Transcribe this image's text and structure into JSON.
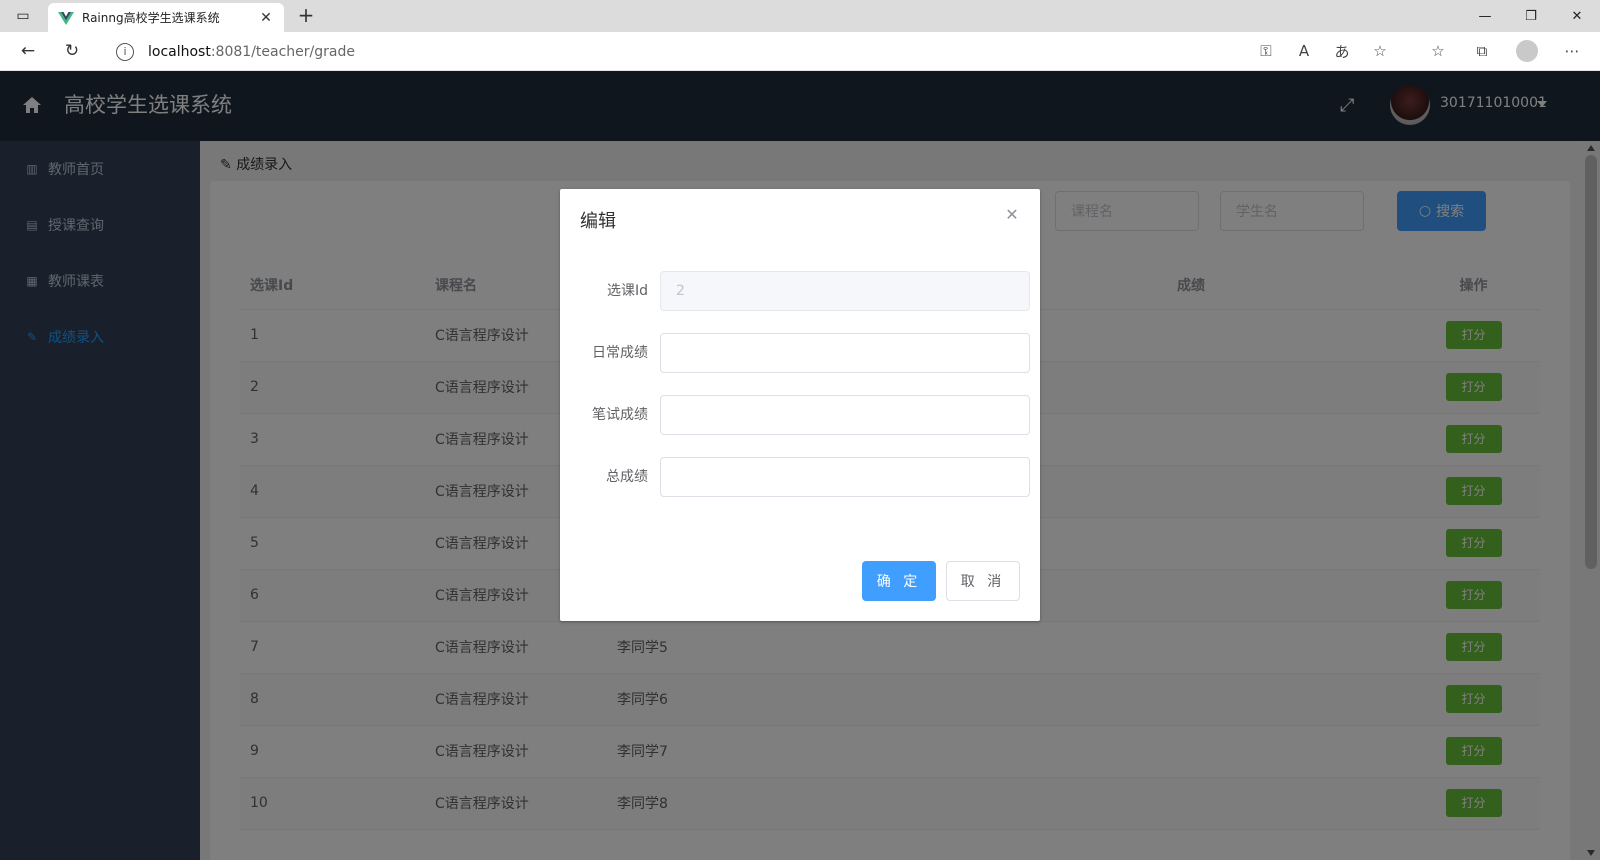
{
  "browser": {
    "tab_title": "Rainng高校学生选课系统",
    "url_host": "localhost",
    "url_path": ":8081/teacher/grade",
    "icons": [
      "sidebar-toggle-icon",
      "vue-logo-icon",
      "close-icon",
      "plus-icon",
      "back-icon",
      "reload-icon",
      "info-icon",
      "key-icon",
      "read-aloud-icon",
      "translate-icon",
      "favorite-add-icon",
      "favorites-icon",
      "collections-icon",
      "profile-icon",
      "more-icon"
    ]
  },
  "header": {
    "title": "高校学生选课系统",
    "username": "301711010001"
  },
  "sidebar": {
    "items": [
      {
        "label": "教师首页",
        "icon": "bar-chart-icon"
      },
      {
        "label": "授课查询",
        "icon": "book-icon"
      },
      {
        "label": "教师课表",
        "icon": "table-icon"
      },
      {
        "label": "成绩录入",
        "icon": "edit-icon",
        "active": true
      }
    ]
  },
  "main": {
    "breadcrumb": "成绩录入",
    "search": {
      "course_placeholder": "课程名",
      "student_placeholder": "学生名",
      "button_label": "搜索"
    },
    "table": {
      "columns": [
        "选课Id",
        "课程名",
        "",
        "",
        "成绩",
        "操作"
      ],
      "action_label": "打分",
      "rows": [
        {
          "id": "1",
          "course": "C语言程序设计",
          "student": ""
        },
        {
          "id": "2",
          "course": "C语言程序设计",
          "student": ""
        },
        {
          "id": "3",
          "course": "C语言程序设计",
          "student": ""
        },
        {
          "id": "4",
          "course": "C语言程序设计",
          "student": ""
        },
        {
          "id": "5",
          "course": "C语言程序设计",
          "student": ""
        },
        {
          "id": "6",
          "course": "C语言程序设计",
          "student": ""
        },
        {
          "id": "7",
          "course": "C语言程序设计",
          "student": "李同学5"
        },
        {
          "id": "8",
          "course": "C语言程序设计",
          "student": "李同学6"
        },
        {
          "id": "9",
          "course": "C语言程序设计",
          "student": "李同学7"
        },
        {
          "id": "10",
          "course": "C语言程序设计",
          "student": "李同学8"
        }
      ]
    }
  },
  "dialog": {
    "title": "编辑",
    "fields": [
      {
        "label": "选课Id",
        "value": "2",
        "disabled": true
      },
      {
        "label": "日常成绩",
        "value": ""
      },
      {
        "label": "笔试成绩",
        "value": ""
      },
      {
        "label": "总成绩",
        "value": ""
      }
    ],
    "ok_label": "确 定",
    "cancel_label": "取 消"
  },
  "colors": {
    "header_bg": "#1f2d3d",
    "sidebar_bg": "#324157",
    "primary": "#409eff",
    "success": "#67c23a",
    "active_menu": "#20a0ff"
  }
}
